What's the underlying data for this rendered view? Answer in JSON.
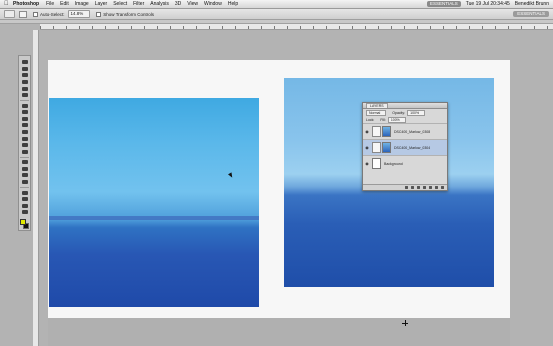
{
  "menubar": {
    "app_name": "Photoshop",
    "items": [
      "File",
      "Edit",
      "Image",
      "Layer",
      "Select",
      "Filter",
      "Analysis",
      "3D",
      "View",
      "Window",
      "Help"
    ],
    "right_badge": "ESSENTIALS",
    "clock": "Tue 19 Jul 20:34:45",
    "user": "Benedikt Brunn"
  },
  "options_bar": {
    "zoom_select": "14.8%",
    "auto_select_label": "Auto-Select:",
    "transform_label": "Show Transform Controls",
    "workspace_button": "ESSENTIALS"
  },
  "layers_panel": {
    "tab_label": "LAYERS",
    "blend_mode": "Normal",
    "opacity_label": "Opacity:",
    "opacity_value": "100%",
    "lock_label": "Lock:",
    "fill_label": "Fill:",
    "fill_value": "100%",
    "layers": [
      {
        "name": "DSC400_Marlow_0308",
        "visible": true,
        "active": false,
        "thumbnail": "photo"
      },
      {
        "name": "DSC400_Marlow_0304",
        "visible": true,
        "active": true,
        "thumbnail": "photo"
      },
      {
        "name": "Background",
        "visible": true,
        "active": false,
        "thumbnail": "white"
      }
    ]
  },
  "colors": {
    "foreground": "#e0e800",
    "background": "#111111",
    "active_layer_highlight": "#b6c9e4"
  }
}
